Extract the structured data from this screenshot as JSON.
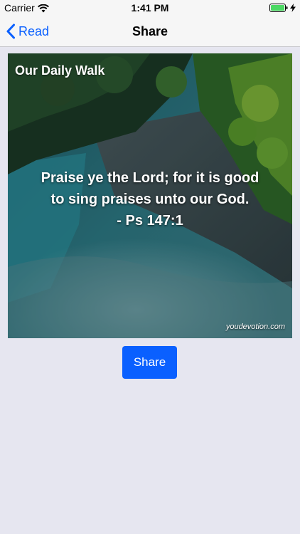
{
  "status_bar": {
    "carrier": "Carrier",
    "time": "1:41 PM",
    "battery_color": "#4cd964"
  },
  "nav": {
    "back_label": "Read",
    "title": "Share",
    "accent_color": "#0a60ff"
  },
  "share_card": {
    "brand": "Our Daily Walk",
    "verse_lines": [
      "Praise ye the Lord; for it is good",
      "to sing praises unto our God.",
      "- Ps 147:1"
    ],
    "watermark": "youdevotion.com"
  },
  "share_button": {
    "label": "Share"
  }
}
